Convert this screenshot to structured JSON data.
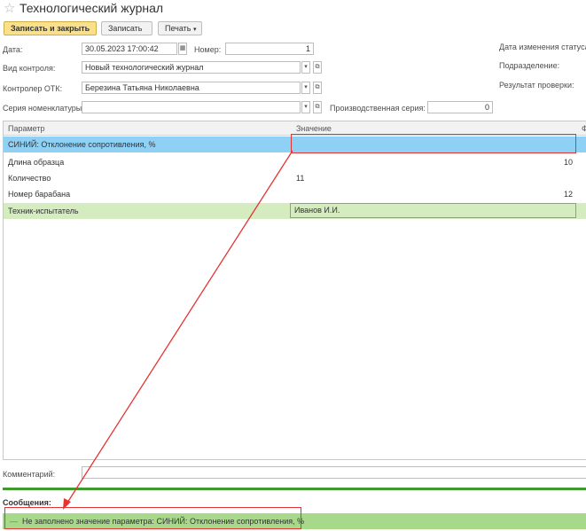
{
  "window": {
    "title": "Технологический журнал"
  },
  "toolbar": {
    "save_close_label": "Записать и закрыть",
    "save_label": "Записать",
    "print_label": "Печать"
  },
  "form": {
    "date_label": "Дата:",
    "date_value": "30.05.2023 17:00:42",
    "number_label": "Номер:",
    "number_value": "1",
    "control_type_label": "Вид контроля:",
    "control_type_value": "Новый технологический журнал",
    "controller_label": "Контролер ОТК:",
    "controller_value": "Березина Татьяна Николаевна",
    "series_label": "Серия номенклатуры:",
    "series_value": "",
    "prod_series_label": "Производственная серия:",
    "prod_series_value": "0",
    "status_date_label": "Дата изменения статуса",
    "department_label": "Подразделение:",
    "result_label": "Результат проверки:"
  },
  "table": {
    "col_param": "Параметр",
    "col_value": "Значение",
    "col_extra": "Ф",
    "rows": [
      {
        "param": "СИНИЙ: Отклонение сопротивления, %",
        "value": ""
      },
      {
        "param": "Длина образца",
        "value": "10"
      },
      {
        "param": "Количество",
        "value": "11"
      },
      {
        "param": "Номер барабана",
        "value": "12"
      },
      {
        "param": "Техник-испытатель",
        "value": "Иванов И.И."
      }
    ]
  },
  "comment": {
    "label": "Комментарий:"
  },
  "messages": {
    "header": "Сообщения:",
    "items": [
      {
        "text": "Не заполнено значение параметра: СИНИЙ: Отклонение сопротивления, %"
      }
    ]
  },
  "colors": {
    "primary_button": "#fbe08a",
    "selected_row": "#8fd0f5",
    "highlight_row": "#d4ecbf",
    "error_annotation": "#e53333",
    "message_bar": "#a8d98a"
  }
}
